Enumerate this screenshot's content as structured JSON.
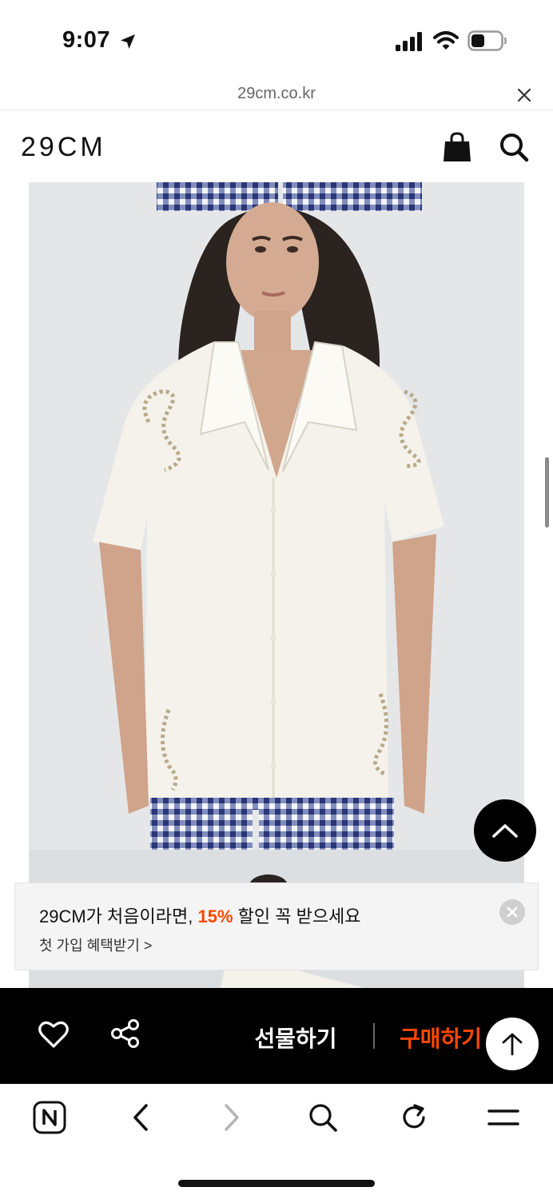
{
  "status_bar": {
    "time": "9:07",
    "icons": [
      "location-arrow-icon",
      "signal-icon",
      "wifi-icon",
      "battery-icon"
    ]
  },
  "url_bar": {
    "domain": "29cm.co.kr",
    "close_icon": "close-icon"
  },
  "header": {
    "logo": "29CM",
    "icons": [
      "shopping-bag-icon",
      "search-icon"
    ]
  },
  "product_image": {
    "alt_semantic": "model-wearing-white-embroidered-shirt"
  },
  "promo": {
    "text_before": "29CM가 처음이라면, ",
    "highlight": "15%",
    "text_after": " 할인 꼭 받으세요",
    "cta": "첫 가입 혜택받기 >",
    "highlight_color": "#ff4800"
  },
  "action_bar": {
    "gift_label": "선물하기",
    "buy_label": "구매하기",
    "buy_color": "#ff4800",
    "icons": [
      "heart-icon",
      "share-icon",
      "arrow-up-icon"
    ]
  },
  "browser_toolbar": {
    "icons": [
      "naver-icon",
      "back-icon",
      "forward-icon",
      "search-icon",
      "refresh-icon",
      "menu-icon"
    ]
  }
}
